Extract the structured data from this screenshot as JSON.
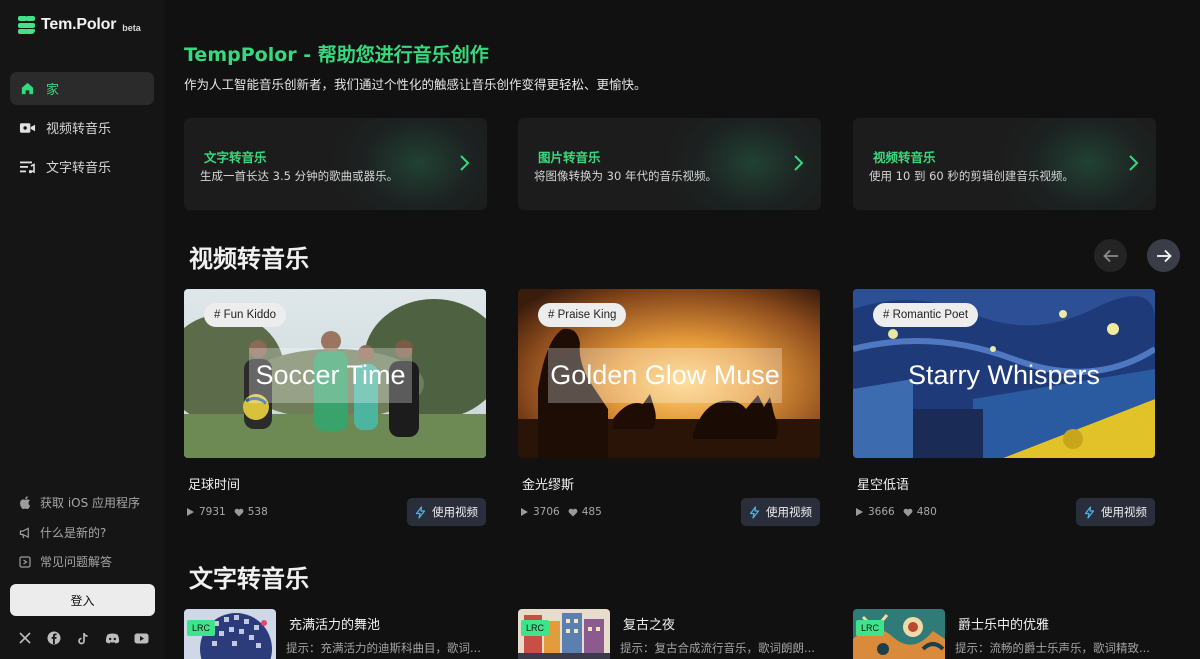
{
  "brand": {
    "name": "Tem.Polor",
    "badge": "beta",
    "accent": "#36d97e"
  },
  "sidebar": {
    "nav": [
      {
        "label": "家",
        "icon": "home-icon",
        "active": true
      },
      {
        "label": "视频转音乐",
        "icon": "video-camera-icon",
        "active": false
      },
      {
        "label": "文字转音乐",
        "icon": "text-lines-icon",
        "active": false
      }
    ],
    "footer": [
      {
        "label": "获取 iOS 应用程序",
        "icon": "apple-icon"
      },
      {
        "label": "什么是新的?",
        "icon": "megaphone-icon"
      },
      {
        "label": "常见问题解答",
        "icon": "faq-icon"
      }
    ],
    "login_label": "登入",
    "socials": [
      "x-icon",
      "facebook-icon",
      "tiktok-icon",
      "discord-icon",
      "youtube-icon"
    ]
  },
  "hero": {
    "title": "TempPolor - 帮助您进行音乐创作",
    "subtitle": "作为人工智能音乐创新者，我们通过个性化的触感让音乐创作变得更轻松、更愉快。"
  },
  "features": [
    {
      "title": "文字转音乐",
      "desc": "生成一首长达 3.5 分钟的歌曲或器乐。"
    },
    {
      "title": "图片转音乐",
      "desc": "将图像转换为 30 年代的音乐视频。"
    },
    {
      "title": "视频转音乐",
      "desc": "使用 10 到 60 秒的剪辑创建音乐视频。"
    }
  ],
  "video_section": {
    "title": "视频转音乐",
    "use_label": "使用视频",
    "cards": [
      {
        "tag": "# Fun Kiddo",
        "thumb_title": "Soccer Time",
        "name": "足球时间",
        "plays": "7931",
        "likes": "538"
      },
      {
        "tag": "# Praise King",
        "thumb_title": "Golden Glow Muse",
        "name": "金光缪斯",
        "plays": "3706",
        "likes": "485"
      },
      {
        "tag": "# Romantic Poet",
        "thumb_title": "Starry Whispers",
        "name": "星空低语",
        "plays": "3666",
        "likes": "480"
      }
    ]
  },
  "text_section": {
    "title": "文字转音乐",
    "badge": "LRC",
    "cards": [
      {
        "name": "充满活力的舞池",
        "prompt": "提示：充满活力的迪斯科曲目，歌词..."
      },
      {
        "name": "复古之夜",
        "prompt": "提示：复古合成流行音乐，歌词朗朗..."
      },
      {
        "name": "爵士乐中的优雅",
        "prompt": "提示：流畅的爵士乐声乐，歌词精致..."
      }
    ]
  }
}
